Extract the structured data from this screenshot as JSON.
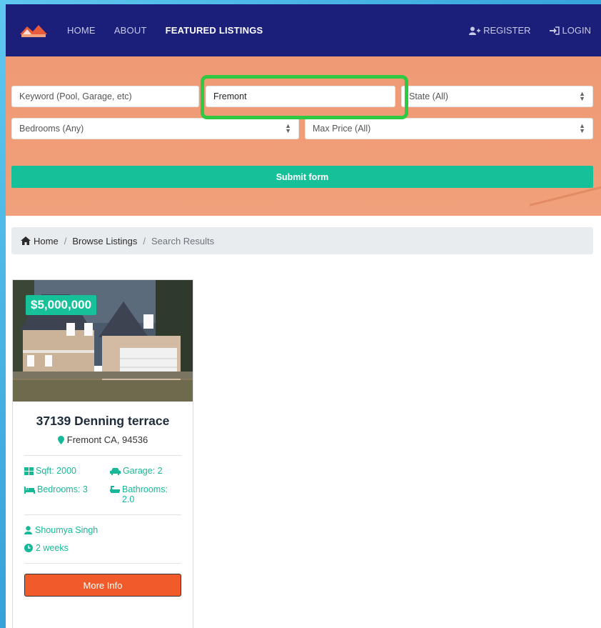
{
  "nav": {
    "links": [
      "HOME",
      "ABOUT",
      "FEATURED LISTINGS"
    ],
    "register": "REGISTER",
    "login": "LOGIN"
  },
  "search": {
    "keyword_placeholder": "Keyword (Pool, Garage, etc)",
    "city_value": "Fremont",
    "state_selected": "State (All)",
    "bedrooms_selected": "Bedrooms (Any)",
    "price_selected": "Max Price (All)",
    "submit_label": "Submit form"
  },
  "breadcrumb": {
    "home": "Home",
    "browse": "Browse Listings",
    "current": "Search Results",
    "separator": "/"
  },
  "listing": {
    "price": "$5,000,000",
    "title": "37139 Denning terrace",
    "location": "Fremont CA, 94536",
    "sqft": "Sqft: 2000",
    "garage": "Garage: 2",
    "bedrooms": "Bedrooms: 3",
    "bathrooms": "Bathrooms: 2.0",
    "realtor": "Shoumya Singh",
    "listed": "2 weeks",
    "more_label": "More Info"
  },
  "colors": {
    "navbar": "#1b1f7a",
    "search_bg": "#ef9a74",
    "accent": "#16c19a",
    "button": "#f05b29",
    "highlight": "#2fc944"
  }
}
